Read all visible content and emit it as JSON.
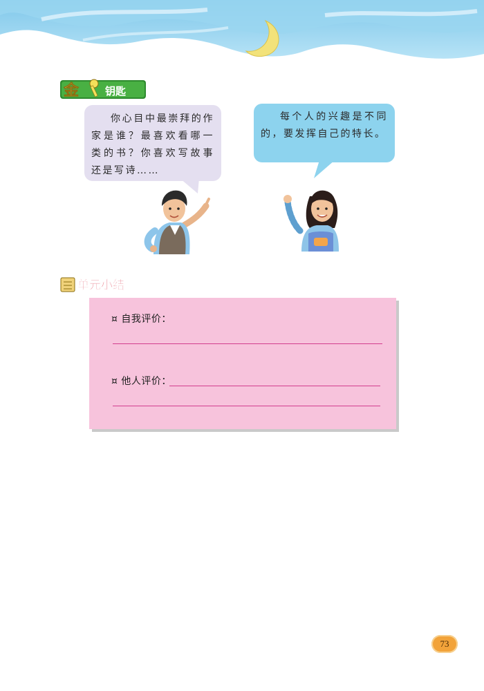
{
  "header": {
    "badge_text": "金钥匙"
  },
  "speech": {
    "left": "你心目中最崇拜的作家是谁？最喜欢看哪一类的书？你喜欢写故事还是写诗……",
    "right": "每个人的兴趣是不同的，要发挥自己的特长。"
  },
  "summary": {
    "title": "单元小结",
    "self_eval_label": "¤ 自我评价：",
    "other_eval_label": "¤ 他人评价："
  },
  "page": {
    "number": "73"
  },
  "colors": {
    "sky": "#8fd0ee",
    "left_bubble": "#e4dff0",
    "right_bubble": "#8dd3ee",
    "eval_box": "#f7c3dc",
    "eval_line": "#d23d8e",
    "page_badge": "#f2a33a"
  }
}
